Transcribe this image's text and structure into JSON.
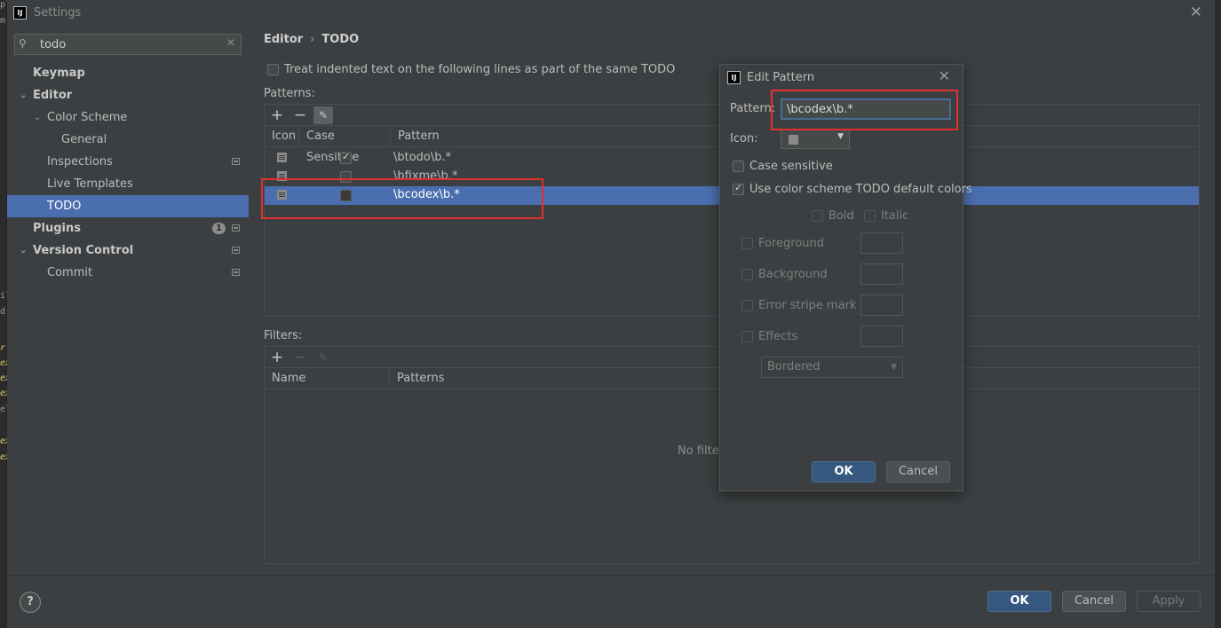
{
  "window": {
    "title": "Settings",
    "app_icon_text": "IJ"
  },
  "search": {
    "value": "todo"
  },
  "sidebar": {
    "items": [
      {
        "label": "Keymap"
      },
      {
        "label": "Editor"
      },
      {
        "label": "Color Scheme"
      },
      {
        "label": "General"
      },
      {
        "label": "Inspections"
      },
      {
        "label": "Live Templates"
      },
      {
        "label": "TODO"
      },
      {
        "label": "Plugins",
        "badge": "1"
      },
      {
        "label": "Version Control"
      },
      {
        "label": "Commit"
      }
    ]
  },
  "breadcrumb": {
    "parent": "Editor",
    "separator": "›",
    "current": "TODO"
  },
  "treat_option": {
    "label": "Treat indented text on the following lines as part of the same TODO",
    "checked": false
  },
  "patterns": {
    "label": "Patterns:",
    "columns": [
      "Icon",
      "Case Sensitive",
      "Pattern"
    ],
    "rows": [
      {
        "pattern": "\\btodo\\b.*",
        "case_sensitive": true
      },
      {
        "pattern": "\\bfixme\\b.*",
        "case_sensitive": false
      },
      {
        "pattern": "\\bcodex\\b.*",
        "case_sensitive": false,
        "selected": true
      }
    ]
  },
  "filters": {
    "label": "Filters:",
    "columns": [
      "Name",
      "Patterns"
    ],
    "empty_text": "No filter"
  },
  "toolbar": {
    "add": "+",
    "remove": "−",
    "edit": "✎"
  },
  "footer": {
    "help": "?",
    "ok": "OK",
    "cancel": "Cancel",
    "apply": "Apply"
  },
  "dialog": {
    "title": "Edit Pattern",
    "pattern_label": "Pattern:",
    "pattern_value": "\\bcodex\\b.*",
    "icon_label": "Icon:",
    "case_sensitive": "Case sensitive",
    "use_default_colors": "Use color scheme TODO default colors",
    "bold": "Bold",
    "italic": "Italic",
    "foreground": "Foreground",
    "background": "Background",
    "error_stripe": "Error stripe mark",
    "effects": "Effects",
    "effect_type": "Bordered",
    "ok": "OK",
    "cancel": "Cancel"
  },
  "colors": {
    "accent": "#4b6eaf",
    "primary_button": "#365880",
    "highlight_box": "#e03030"
  }
}
